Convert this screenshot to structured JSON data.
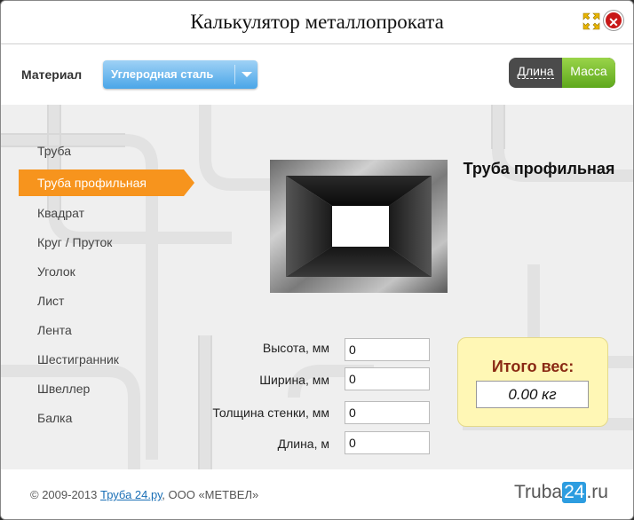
{
  "window": {
    "title": "Калькулятор металлопроката"
  },
  "toolbar": {
    "material_label": "Материал",
    "material_value": "Углеродная сталь",
    "toggle": {
      "length_label": "Длина",
      "mass_label": "Масса",
      "active": "Масса"
    }
  },
  "sidebar": {
    "items": [
      {
        "label": "Труба"
      },
      {
        "label": "Труба профильная",
        "active": true
      },
      {
        "label": "Квадрат"
      },
      {
        "label": "Круг / Пруток"
      },
      {
        "label": "Уголок"
      },
      {
        "label": "Лист"
      },
      {
        "label": "Лента"
      },
      {
        "label": "Шестигранник"
      },
      {
        "label": "Швеллер"
      },
      {
        "label": "Балка"
      }
    ]
  },
  "product": {
    "title": "Труба профильная"
  },
  "form": {
    "fields": [
      {
        "label": "Высота, мм",
        "value": "0"
      },
      {
        "label": "Ширина, мм",
        "value": "0"
      },
      {
        "label": "Толщина стенки, мм",
        "value": "0"
      },
      {
        "label": "Длина, м",
        "value": "0"
      }
    ]
  },
  "result": {
    "label": "Итого вес:",
    "value": "0.00 кг"
  },
  "footer": {
    "copyright_prefix": "© 2009-2013",
    "link_text": "Труба 24.ру",
    "copyright_suffix": ", ООО «МЕТВЕЛ»",
    "logo_text": "Truba",
    "logo_num": "24",
    "logo_domain": ".ru"
  },
  "colors": {
    "accent": "#f7941d",
    "select": "#4aa6e8",
    "toggle_active": "#7cc232",
    "result_bg": "#fff7b5",
    "close": "#c81818"
  },
  "icons": {
    "maximize": "maximize-icon",
    "close": "close-icon",
    "dropdown": "chevron-down-icon"
  }
}
